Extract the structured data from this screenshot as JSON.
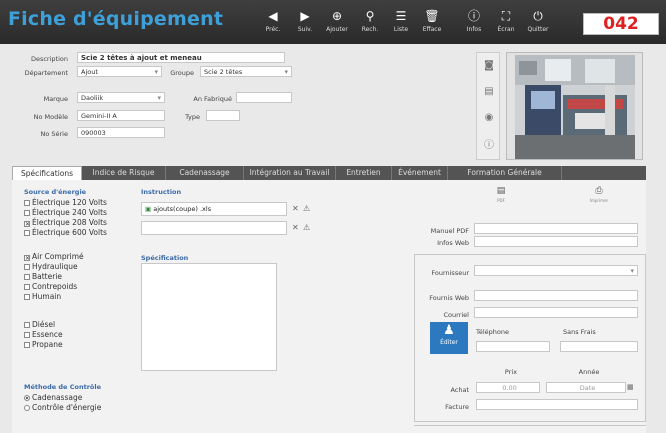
{
  "header": {
    "title": "Fiche d'équipement",
    "toolbar": [
      {
        "icon": "arrow-left-icon",
        "glyph": "◀",
        "label": "Préc."
      },
      {
        "icon": "arrow-right-icon",
        "glyph": "▶",
        "label": "Suiv."
      },
      {
        "icon": "add-icon",
        "glyph": "⊕",
        "label": "Ajouter"
      },
      {
        "icon": "search-icon",
        "glyph": "⚲",
        "label": "Rech."
      },
      {
        "icon": "list-icon",
        "glyph": "☰",
        "label": "Liste"
      },
      {
        "icon": "trash-icon",
        "glyph": "🗑",
        "label": "Efface"
      },
      {
        "icon": "info-icon",
        "glyph": "ⓘ",
        "label": "Infos"
      },
      {
        "icon": "fullscreen-icon",
        "glyph": "⛶",
        "label": "Écran"
      },
      {
        "icon": "power-icon",
        "glyph": "⏻",
        "label": "Quitter"
      }
    ],
    "counter": "042"
  },
  "form": {
    "description_label": "Description",
    "description": "Scie 2 têtes à ajout et meneau",
    "departement_label": "Département",
    "departement": "Ajout",
    "groupe_label": "Groupe",
    "groupe": "Scie 2 têtes",
    "marque_label": "Marque",
    "marque": "Daoliik",
    "an_fabrique_label": "An Fabriqué",
    "an_fabrique": "",
    "no_modele_label": "No Modèle",
    "no_modele": "Gemini-II A",
    "type_label": "Type",
    "type": "",
    "no_serie_label": "No Série",
    "no_serie": "090003"
  },
  "tabs": [
    "Spécifications",
    "Indice de Risque",
    "Cadenassage",
    "Intégration au Travail",
    "Entretien",
    "Événement",
    "Formation Générale"
  ],
  "specs": {
    "source_title": "Source d'énergie",
    "electric": [
      {
        "label": "Électrique 120 Volts",
        "checked": false
      },
      {
        "label": "Électrique 240 Volts",
        "checked": false
      },
      {
        "label": "Électrique 208 Volts",
        "checked": true
      },
      {
        "label": "Électrique 600 Volts",
        "checked": false
      }
    ],
    "other": [
      {
        "label": "Air Comprimé",
        "checked": true
      },
      {
        "label": "Hydraulique",
        "checked": false
      },
      {
        "label": "Batterie",
        "checked": false
      },
      {
        "label": "Contrepoids",
        "checked": false
      },
      {
        "label": "Humain",
        "checked": false
      }
    ],
    "fuel": [
      {
        "label": "Diésel",
        "checked": false
      },
      {
        "label": "Essence",
        "checked": false
      },
      {
        "label": "Propane",
        "checked": false
      }
    ],
    "methode_title": "Méthode de Contrôle",
    "methodes": [
      {
        "label": "Cadenassage",
        "selected": true
      },
      {
        "label": "Contrôle d'énergie",
        "selected": false
      }
    ],
    "instruction_title": "Instruction",
    "instruction_file": "ajouts(coupe) .xls",
    "instruction_file2": "",
    "specification_title": "Spécification",
    "specification": ""
  },
  "right": {
    "pdf_label": "PDF",
    "print_label": "Imprimer",
    "manuel_pdf_label": "Manuel PDF",
    "manuel_pdf": "",
    "infos_web_label": "Infos Web",
    "infos_web": "",
    "fournisseur_label": "Fournisseur",
    "fournisseur": "",
    "fournis_web_label": "Fournis Web",
    "fournis_web": "",
    "courriel_label": "Courriel",
    "courriel": "",
    "editer_label": "Éditer",
    "telephone_label": "Téléphone",
    "telephone": "",
    "sans_frais_label": "Sans Frais",
    "sans_frais": "",
    "prix_label": "Prix",
    "annee_label": "Année",
    "achat_label": "Achat",
    "achat_prix": "0.00",
    "achat_annee": "Date",
    "facture_label": "Facture",
    "facture": ""
  }
}
